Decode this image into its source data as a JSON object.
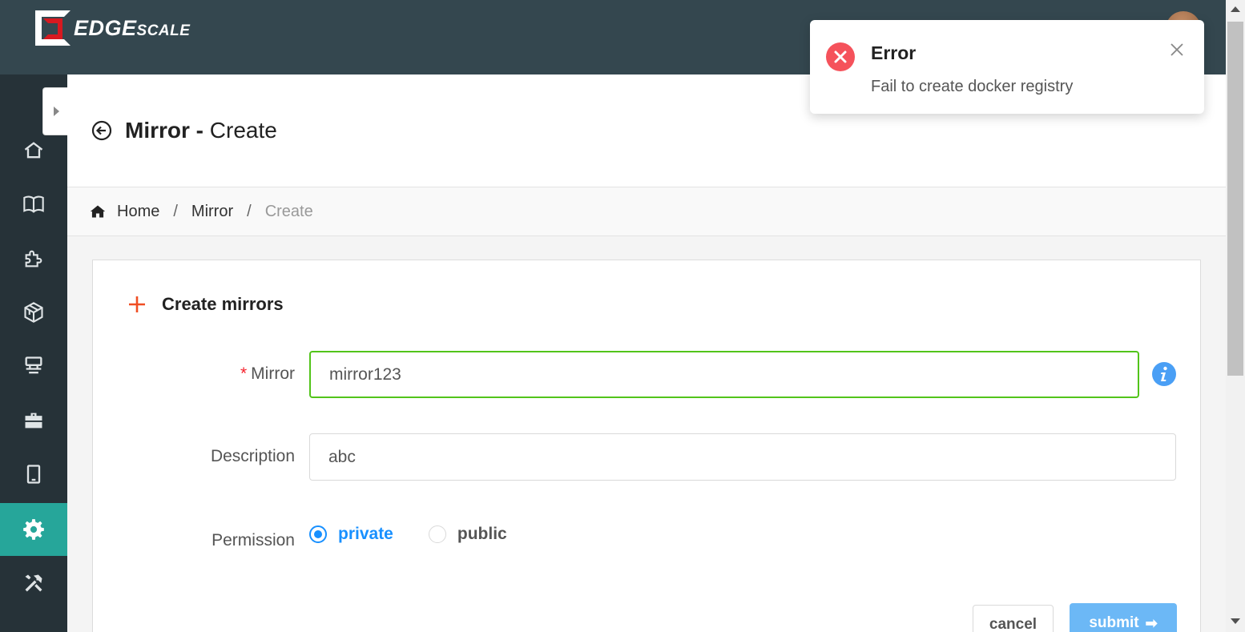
{
  "header": {
    "brand_big": "EDGE",
    "brand_small": "SCALE"
  },
  "sidebar": {
    "items": [
      {
        "icon": "home-icon"
      },
      {
        "icon": "book-icon"
      },
      {
        "icon": "puzzle-icon"
      },
      {
        "icon": "cube-icon"
      },
      {
        "icon": "server-icon"
      },
      {
        "icon": "briefcase-icon"
      },
      {
        "icon": "tablet-icon"
      },
      {
        "icon": "gear-icon",
        "active": true
      },
      {
        "icon": "tools-icon"
      }
    ],
    "active_color": "#26a69a"
  },
  "page": {
    "title_strong": "Mirror",
    "title_sep": " - ",
    "title_rest": "Create"
  },
  "breadcrumb": {
    "home": "Home",
    "sep": "/",
    "mirror": "Mirror",
    "current": "Create"
  },
  "form": {
    "card_title": "Create mirrors",
    "mirror_label": "Mirror",
    "mirror_value": "mirror123",
    "description_label": "Description",
    "description_value": "abc",
    "permission_label": "Permission",
    "permission_options": [
      "private",
      "public"
    ],
    "permission_selected": "private",
    "cancel_label": "cancel",
    "submit_label": "submit"
  },
  "notification": {
    "title": "Error",
    "message": "Fail to create docker registry",
    "type": "error",
    "color": "#f5525b"
  }
}
